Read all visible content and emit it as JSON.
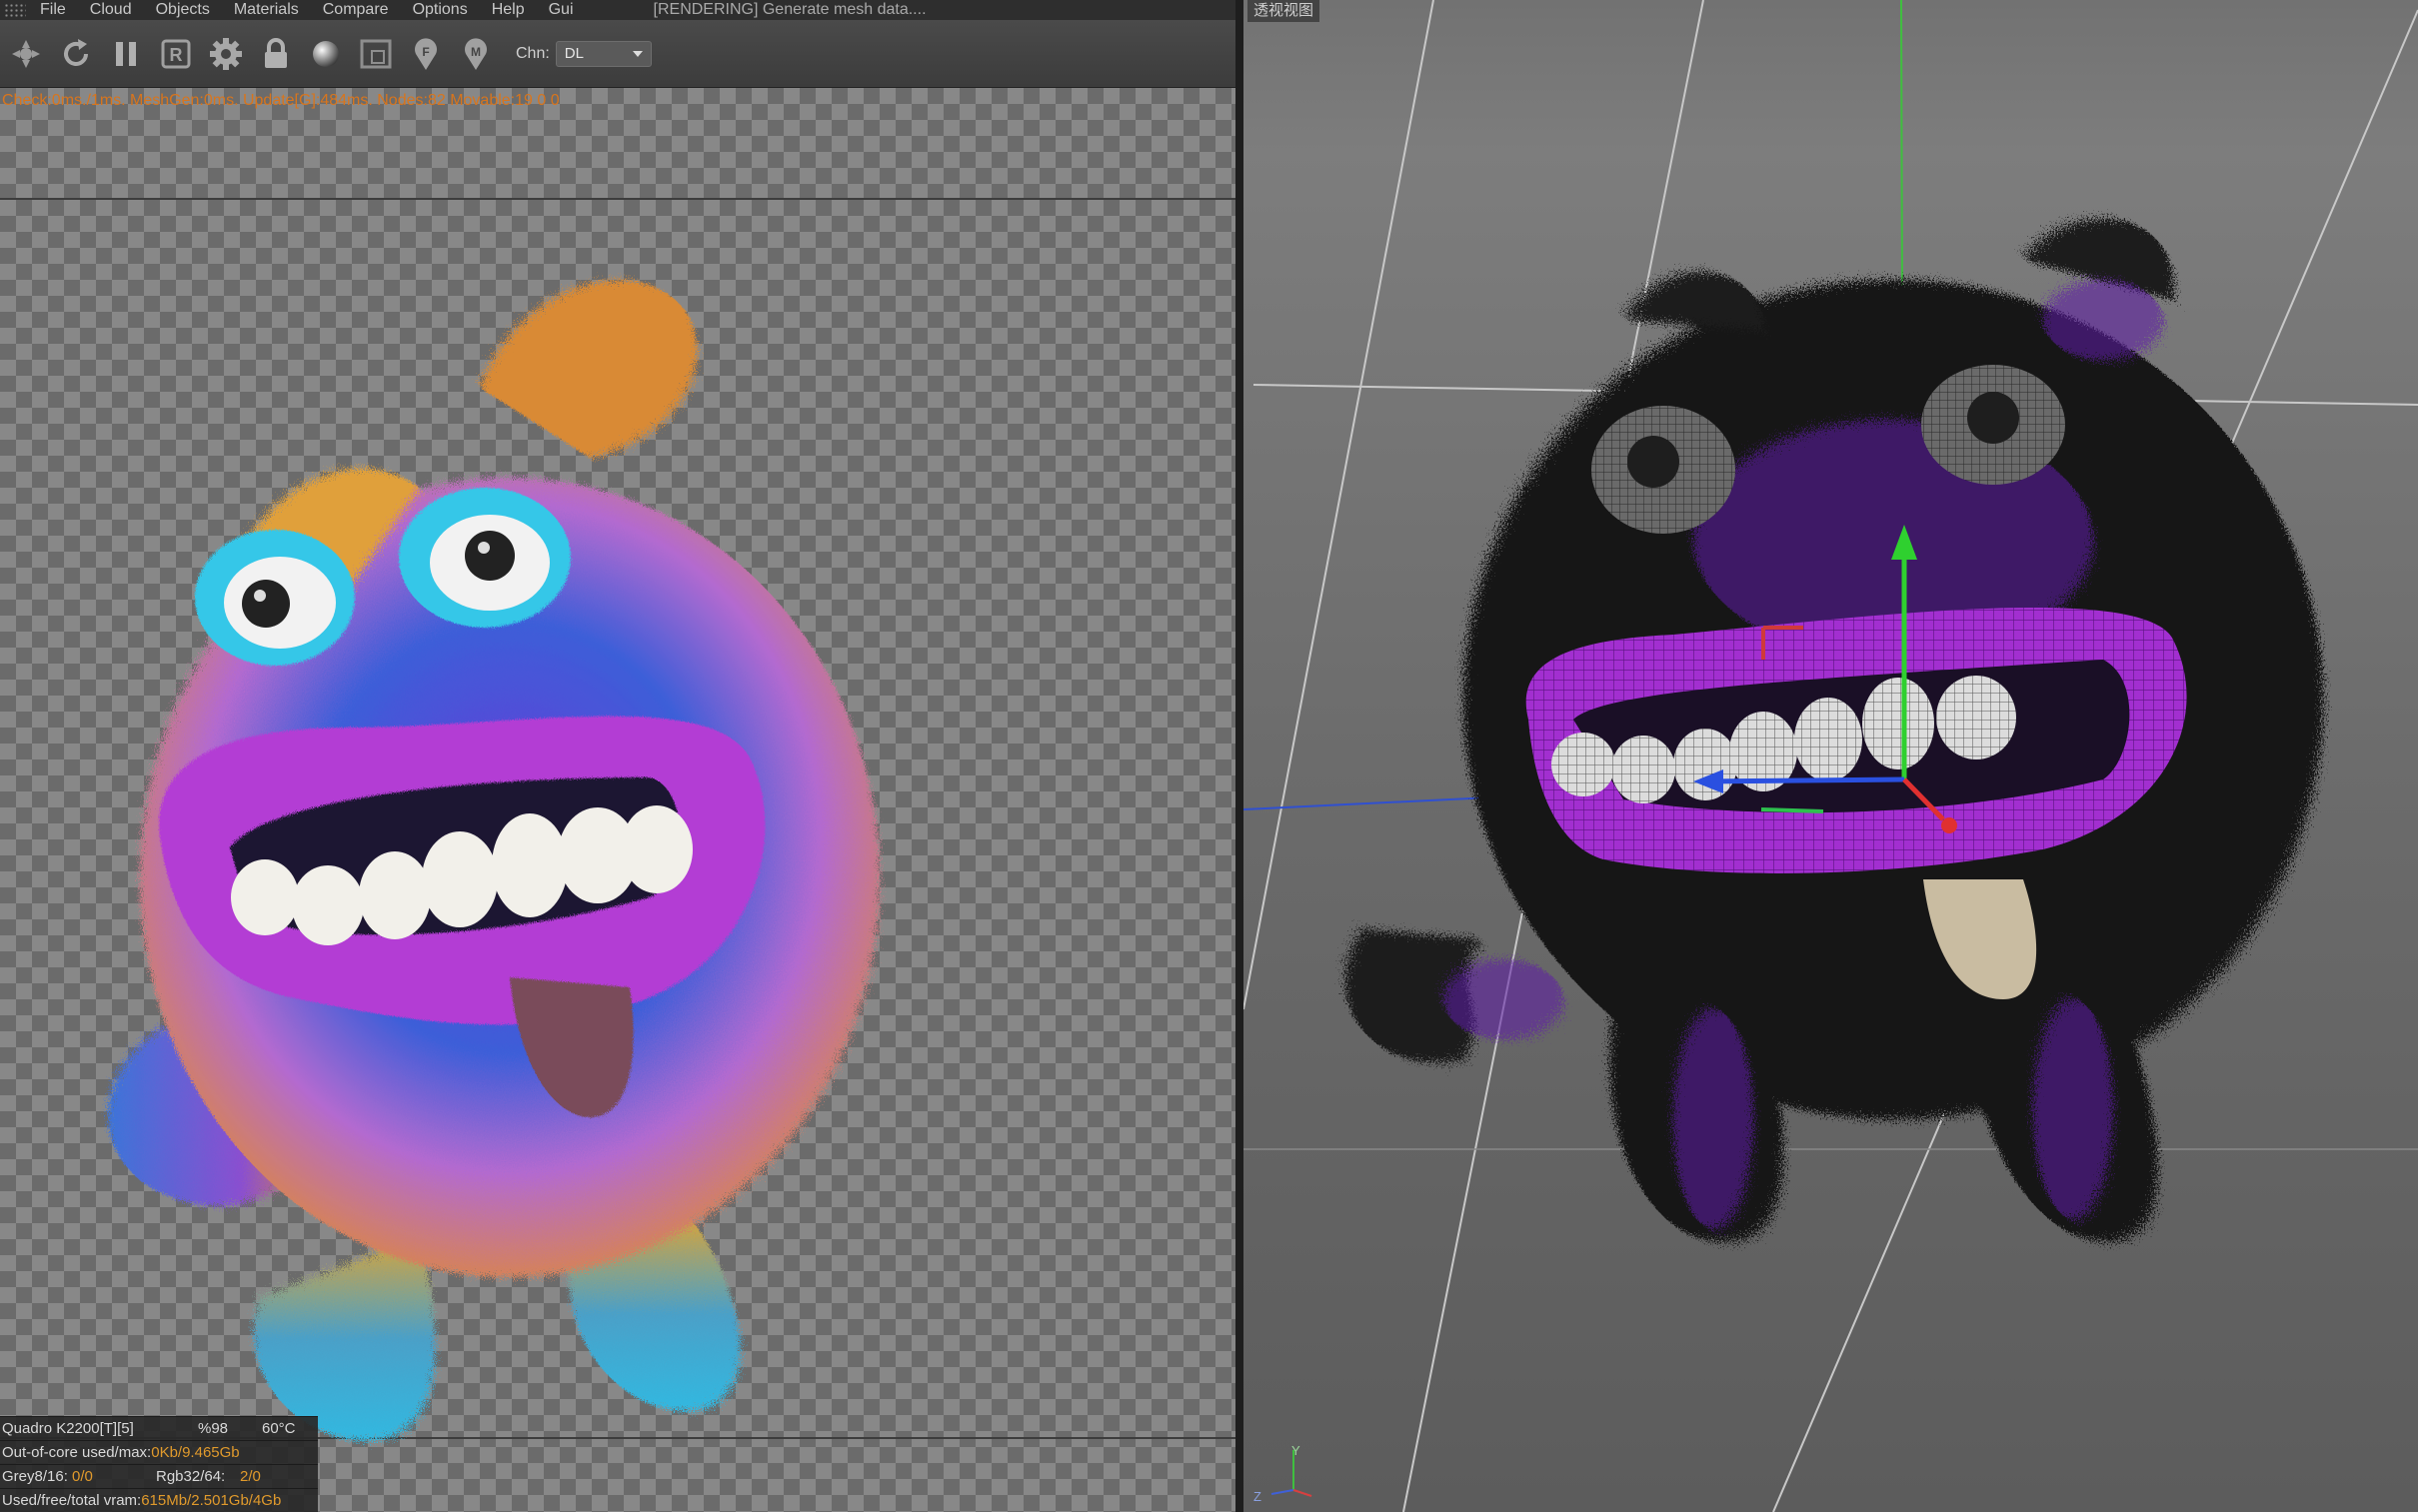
{
  "menubar": {
    "items": [
      "File",
      "Cloud",
      "Objects",
      "Materials",
      "Compare",
      "Options",
      "Help",
      "Gui"
    ],
    "status": "[RENDERING] Generate mesh data...."
  },
  "toolbar": {
    "buttons": [
      "lock-camera-icon",
      "refresh-icon",
      "pause-icon",
      "region-icon",
      "settings-icon",
      "lock-icon",
      "material-ball-icon",
      "frame-icon",
      "pick-focus-icon",
      "pick-material-icon"
    ],
    "channel_label": "Chn:",
    "channel_value": "DL"
  },
  "render": {
    "stats": "Check:0ms./1ms. MeshGen:0ms. Update[G]:484ms. Nodes:82 Movable:19  0 0"
  },
  "gpu": {
    "name": "Quadro K2200[T][5]",
    "usage": "%98",
    "temp": "60°C",
    "out_of_core_label": "Out-of-core used/max:",
    "out_of_core_value": "0Kb/9.465Gb",
    "grey_label": "Grey8/16:",
    "grey_value": "0/0",
    "rgb_label": "Rgb32/64:",
    "rgb_value": "2/0",
    "vram_label": "Used/free/total vram:",
    "vram_value": "615Mb/2.501Gb/4Gb"
  },
  "viewport": {
    "title": "透视视图",
    "axis_y": "Y",
    "axis_z": "Z"
  },
  "colors": {
    "accent_orange": "#d8751d",
    "gpu_highlight": "#e09a2c",
    "lip_purple": "#a62fd0",
    "fur_purple": "#6a22b8"
  }
}
